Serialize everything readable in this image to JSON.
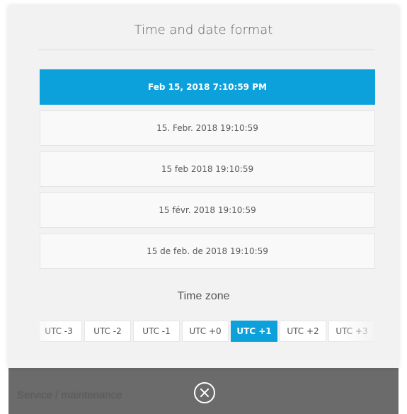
{
  "dialog": {
    "title": "Time and date format",
    "formats": [
      {
        "label": "Feb 15, 2018 7:10:59 PM",
        "selected": true
      },
      {
        "label": "15. Febr. 2018 19:10:59",
        "selected": false
      },
      {
        "label": "15 feb 2018 19:10:59",
        "selected": false
      },
      {
        "label": "15 févr. 2018 19:10:59",
        "selected": false
      },
      {
        "label": "15 de feb. de 2018 19:10:59",
        "selected": false
      }
    ],
    "timezone_label": "Time zone",
    "timezones": [
      {
        "label": "UTC -3",
        "selected": false
      },
      {
        "label": "UTC -2",
        "selected": false
      },
      {
        "label": "UTC -1",
        "selected": false
      },
      {
        "label": "UTC +0",
        "selected": false
      },
      {
        "label": "UTC +1",
        "selected": true
      },
      {
        "label": "UTC +2",
        "selected": false
      },
      {
        "label": "UTC +3",
        "selected": false
      }
    ],
    "close_icon": "close-circle-icon"
  },
  "background": {
    "menu_text": "Service / maintenance"
  },
  "colors": {
    "accent": "#0da1dc",
    "panel_bg": "#f2f2f2",
    "bottom_bar": "#6b6b6b"
  }
}
